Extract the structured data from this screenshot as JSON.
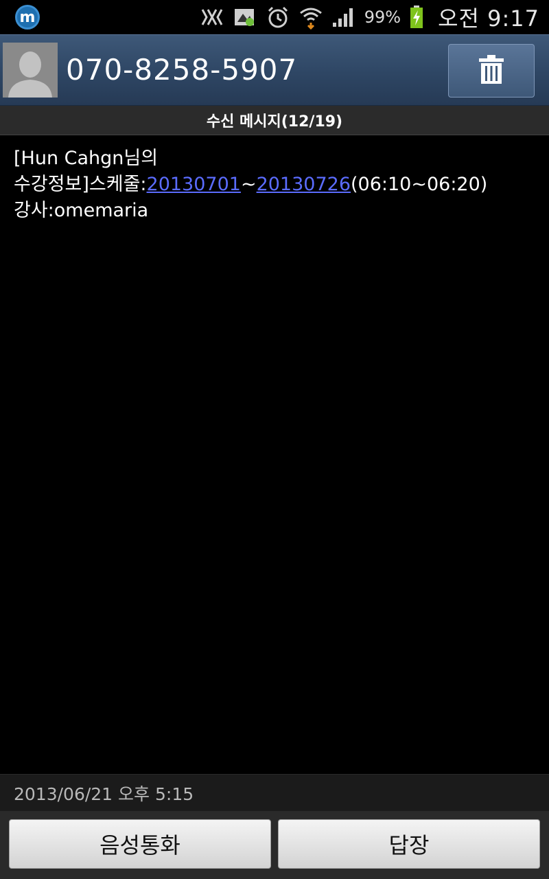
{
  "status_bar": {
    "notification_icon_label": "m",
    "battery_percent": "99%",
    "time": "오전 9:17",
    "icons": [
      "nfc-icon",
      "sim-icon",
      "alarm-icon",
      "wifi-icon",
      "signal-icon",
      "battery-charging-icon"
    ]
  },
  "header": {
    "contact_number": "070-8258-5907",
    "avatar_icon": "default-contact-icon",
    "delete_icon": "trash-icon"
  },
  "subheader": {
    "title": "수신 메시지(12/19)"
  },
  "message": {
    "line1": "[Hun Cahgn님의",
    "line2_prefix": "수강정보]스케줄:",
    "link1": "20130701",
    "separator": "~",
    "link2": "20130726",
    "line2_suffix": "(06:10~06:20)",
    "line3": "강사:omemaria"
  },
  "timestamp": "2013/06/21 오후 5:15",
  "buttons": {
    "voice_call": "음성통화",
    "reply": "답장"
  },
  "colors": {
    "header": "#2e4664",
    "link": "#5b6cff",
    "background": "#000000"
  }
}
